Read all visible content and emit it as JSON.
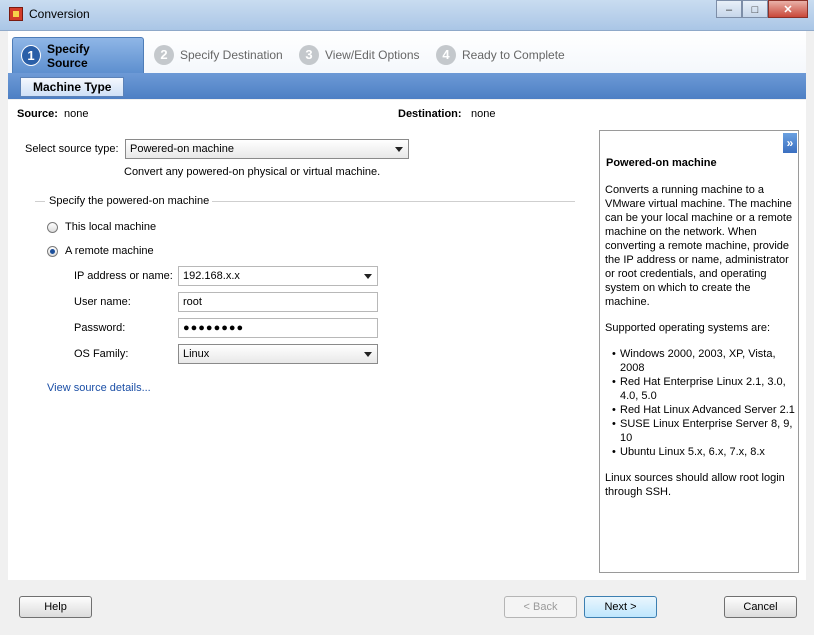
{
  "window": {
    "title": "Conversion",
    "controls": {
      "minimize": "–",
      "maximize": "□",
      "close": "✕"
    }
  },
  "steps": [
    {
      "num": "1",
      "label": "Specify Source"
    },
    {
      "num": "2",
      "label": "Specify Destination"
    },
    {
      "num": "3",
      "label": "View/Edit Options"
    },
    {
      "num": "4",
      "label": "Ready to Complete"
    }
  ],
  "subtab": {
    "label": "Machine Type"
  },
  "summary": {
    "source_label": "Source:",
    "source_value": "none",
    "destination_label": "Destination:",
    "destination_value": "none"
  },
  "source_type": {
    "label": "Select source type:",
    "value": "Powered-on machine",
    "description": "Convert any powered-on physical or virtual machine."
  },
  "group": {
    "title": "Specify the powered-on machine",
    "local_option": "This local machine",
    "remote_option": "A remote machine",
    "selected": "remote"
  },
  "form": {
    "ip_label": "IP address or name:",
    "ip_value": "192.168.x.x",
    "user_label": "User name:",
    "user_value": "root",
    "password_label": "Password:",
    "password_value": "●●●●●●●●",
    "os_label": "OS Family:",
    "os_value": "Linux"
  },
  "link": {
    "view_source_details": "View source details..."
  },
  "help": {
    "collapse_glyph": "»",
    "title": "Powered-on machine",
    "paragraph1_lines": [
      "Converts a running machine to a",
      "VMware virtual machine. The machine",
      "can be your local machine or a remote",
      "machine on the network. When",
      "converting a remote machine, provide",
      "the IP address or name, administrator",
      "or root credentials, and operating",
      "system on which to create the",
      "machine."
    ],
    "supported_heading": "Supported operating systems are:",
    "os_items": [
      [
        "Windows 2000, 2003, XP, Vista,",
        "2008"
      ],
      [
        "Red Hat Enterprise Linux 2.1, 3.0,",
        "4.0, 5.0"
      ],
      [
        "Red Hat Linux Advanced Server 2.1"
      ],
      [
        "SUSE Linux Enterprise Server 8, 9,",
        "10"
      ],
      [
        "Ubuntu Linux 5.x, 6.x, 7.x, 8.x"
      ]
    ],
    "footer_lines": [
      "Linux sources should allow root login",
      "through SSH."
    ]
  },
  "buttons": {
    "help": "Help",
    "back": "< Back",
    "next": "Next >",
    "cancel": "Cancel"
  }
}
